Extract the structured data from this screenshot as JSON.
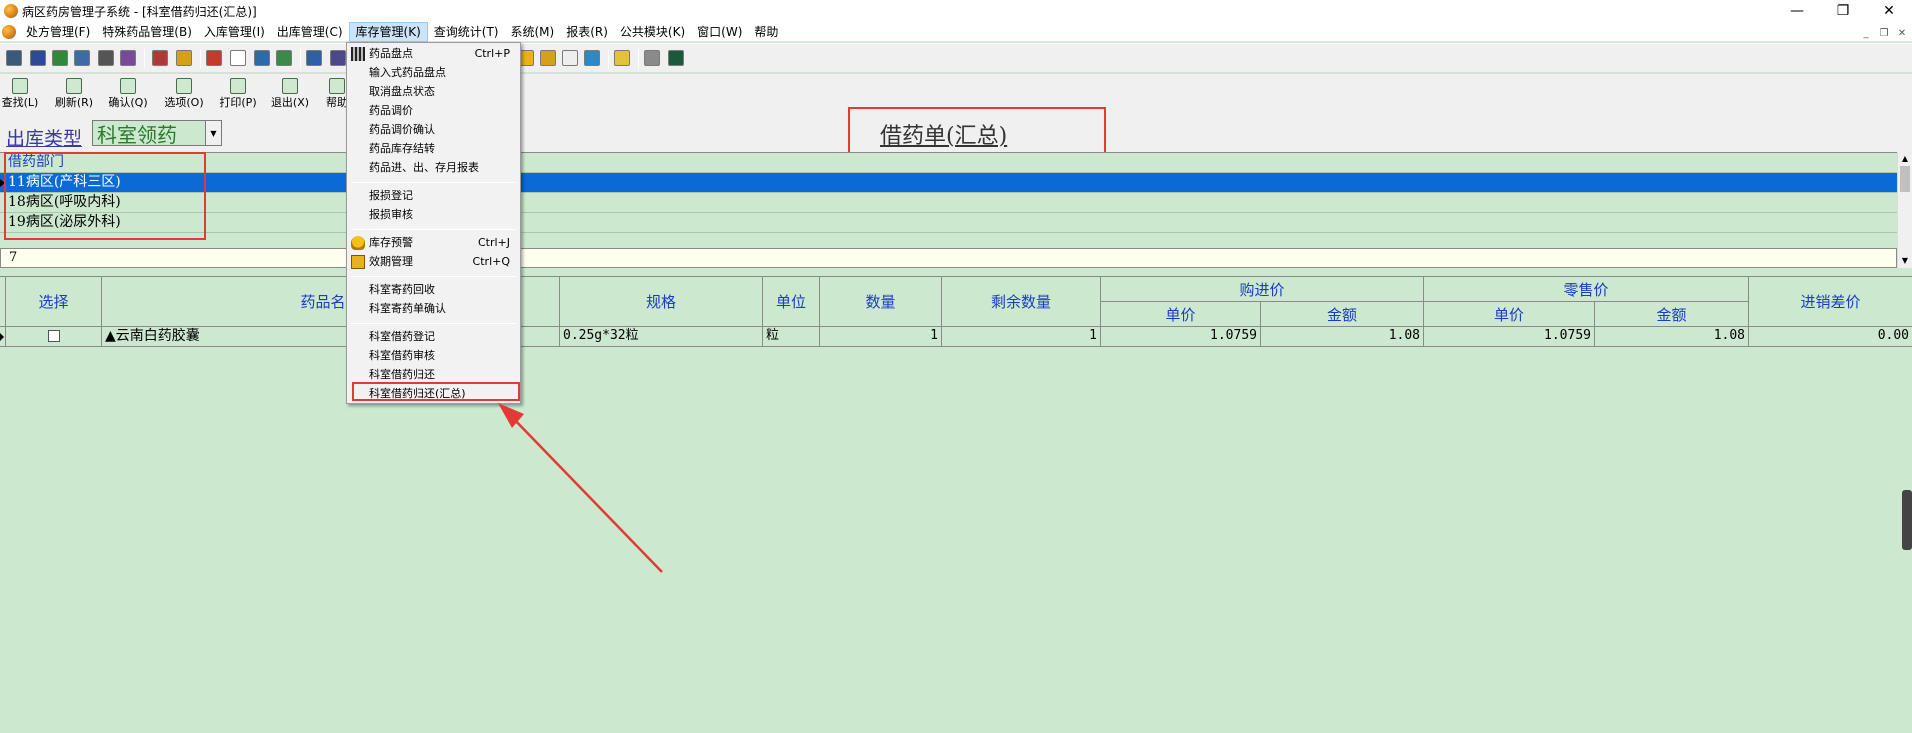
{
  "window": {
    "title": "病区药房管理子系统 - [科室借药归还(汇总)]",
    "controls": [
      "—",
      "❐",
      "✕"
    ]
  },
  "menubar": {
    "items": [
      "处方管理(F)",
      "特殊药品管理(B)",
      "入库管理(I)",
      "出库管理(C)",
      "库存管理(K)",
      "查询统计(T)",
      "系统(M)",
      "报表(R)",
      "公共模块(K)",
      "窗口(W)",
      "帮助"
    ],
    "active_index": 4
  },
  "mdi_controls": [
    "_",
    "❐",
    "✕"
  ],
  "toolbar2": {
    "buttons": [
      "查找(L)",
      "刷新(R)",
      "确认(Q)",
      "选项(O)",
      "打印(P)",
      "退出(X)",
      "帮助"
    ]
  },
  "filter": {
    "outbound_type_label": "出库类型",
    "outbound_type_value": "科室领药"
  },
  "document_title": "借药单(汇总)",
  "dept_list": {
    "header": "借药部门",
    "rows": [
      "11病区(产科三区)",
      "18病区(呼吸内科)",
      "19病区(泌尿外科)"
    ],
    "selected_index": 0
  },
  "count_value": "7",
  "grid": {
    "headers": {
      "select": "选择",
      "drug_name": "药品名称",
      "spec": "规格",
      "unit": "单位",
      "quantity": "数量",
      "remaining": "剩余数量",
      "purchase_price": "购进价",
      "retail_price": "零售价",
      "unit_price": "单价",
      "amount": "金额",
      "diff": "进销差价"
    },
    "rows": [
      {
        "drug_name": "▲云南白药胶囊",
        "spec": "0.25g*32粒",
        "unit": "粒",
        "quantity": "1",
        "remaining": "1",
        "purchase_unit_price": "1.0759",
        "purchase_amount": "1.08",
        "retail_unit_price": "1.0759",
        "retail_amount": "1.08",
        "diff": "0.00"
      }
    ]
  },
  "dropdown": {
    "items": [
      {
        "label": "药品盘点",
        "shortcut": "Ctrl+P"
      },
      {
        "label": "输入式药品盘点"
      },
      {
        "label": "取消盘点状态"
      },
      {
        "label": "药品调价"
      },
      {
        "label": "药品调价确认"
      },
      {
        "label": "药品库存结转"
      },
      {
        "label": "药品进、出、存月报表"
      },
      {
        "label": "报损登记"
      },
      {
        "label": "报损审核"
      },
      {
        "label": "库存预警",
        "shortcut": "Ctrl+J"
      },
      {
        "label": "效期管理",
        "shortcut": "Ctrl+Q"
      },
      {
        "label": "科室寄药回收"
      },
      {
        "label": "科室寄药单确认"
      },
      {
        "label": "科室借药登记"
      },
      {
        "label": "科室借药审核"
      },
      {
        "label": "科室借药归还"
      },
      {
        "label": "科室借药归还(汇总)"
      }
    ]
  },
  "colors": {
    "background": "#cce8cf",
    "selection": "#0b6ad6",
    "annotation": "#e53935",
    "header_text": "#1a3cc8"
  }
}
